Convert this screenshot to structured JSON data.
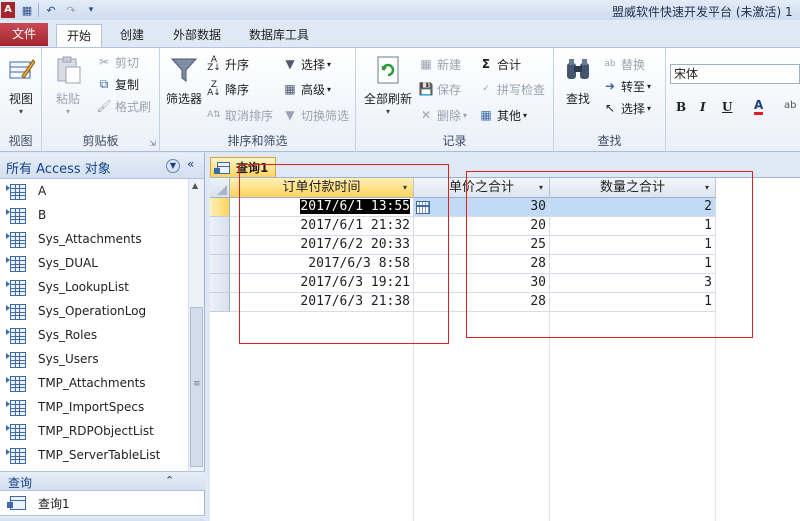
{
  "titlebar": {
    "app_icon": "A",
    "title": "盟威软件快速开发平台 (未激活) 1"
  },
  "ribbon_tabs": {
    "file": "文件",
    "tabs": [
      "开始",
      "创建",
      "外部数据",
      "数据库工具"
    ]
  },
  "ribbon": {
    "view": {
      "label": "视图",
      "group": "视图"
    },
    "clipboard": {
      "paste": "粘贴",
      "cut": "剪切",
      "copy": "复制",
      "format_painter": "格式刷",
      "group": "剪贴板"
    },
    "sort_filter": {
      "filter": "筛选器",
      "ascending": "升序",
      "descending": "降序",
      "clear_sort": "取消排序",
      "selection": "选择",
      "advanced": "高级",
      "toggle_filter": "切换筛选",
      "group": "排序和筛选"
    },
    "records": {
      "refresh_all": "全部刷新",
      "new": "新建",
      "save": "保存",
      "delete": "删除",
      "totals": "合计",
      "spelling": "拼写检查",
      "more": "其他",
      "group": "记录"
    },
    "find": {
      "find": "查找",
      "replace": "替换",
      "goto": "转至",
      "select": "选择",
      "group": "查找"
    },
    "text_format": {
      "font": "宋体",
      "bold": "B",
      "italic": "I",
      "underline": "U",
      "font_color": "A",
      "more": "ab"
    }
  },
  "nav_pane": {
    "title": "所有 Access 对象",
    "tables": [
      "A",
      "B",
      "Sys_Attachments",
      "Sys_DUAL",
      "Sys_LookupList",
      "Sys_OperationLog",
      "Sys_Roles",
      "Sys_Users",
      "TMP_Attachments",
      "TMP_ImportSpecs",
      "TMP_RDPObjectList",
      "TMP_ServerTableList"
    ],
    "query_section": "查询",
    "queries": [
      "查询1"
    ]
  },
  "document": {
    "tab": "查询1",
    "columns": [
      "订单付款时间",
      "单价之合计",
      "数量之合计"
    ],
    "rows": [
      [
        "2017/6/1 13:55",
        "30",
        "2"
      ],
      [
        "2017/6/1 21:32",
        "20",
        "1"
      ],
      [
        "2017/6/2 20:33",
        "25",
        "1"
      ],
      [
        "2017/6/3 8:58",
        "28",
        "1"
      ],
      [
        "2017/6/3 19:21",
        "30",
        "3"
      ],
      [
        "2017/6/3 21:38",
        "28",
        "1"
      ]
    ]
  },
  "colors": {
    "file_tab": "#a4262c",
    "active_header": "#ffd35c",
    "selected_row": "#c2daf5",
    "annotation_box": "#e02020"
  }
}
